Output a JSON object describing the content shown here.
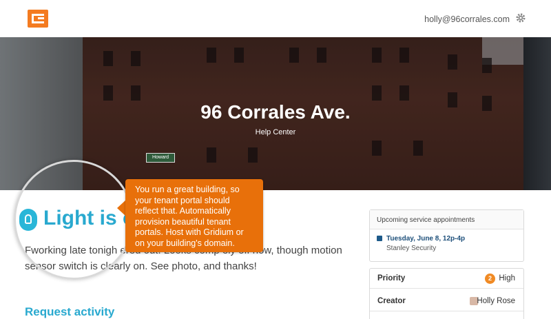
{
  "header": {
    "logo_icon": "gridium-logo-icon",
    "user_email": "holly@96corrales.com",
    "settings_icon": "gear-icon"
  },
  "hero": {
    "title": "96 Corrales Ave.",
    "subtitle": "Help Center",
    "street_sign": "Howard"
  },
  "issue": {
    "icon": "lightbulb-icon",
    "title": "Light is o",
    "description": "Fworking late tonigh                               ered out. Looks comp    ely off now, though motion sensor switch is clearly on. See photo, and thanks!",
    "activity_heading": "Request activity"
  },
  "tooltip": {
    "text": "You run a great building, so your tenant portal should reflect that. Automatically provision beautiful tenant portals. Host with Gridium or on your building's domain."
  },
  "appointments": {
    "header": "Upcoming service appointments",
    "date": "Tuesday, June 8, 12p-4p",
    "vendor": "Stanley Security",
    "icon": "calendar-icon"
  },
  "properties": {
    "priority_label": "Priority",
    "priority_badge": "2",
    "priority_value": "High",
    "creator_label": "Creator",
    "creator_value": "Holly Rose"
  },
  "colors": {
    "accent_orange": "#e8700a",
    "accent_blue": "#29a9cf",
    "link_navy": "#1d4f7a"
  }
}
